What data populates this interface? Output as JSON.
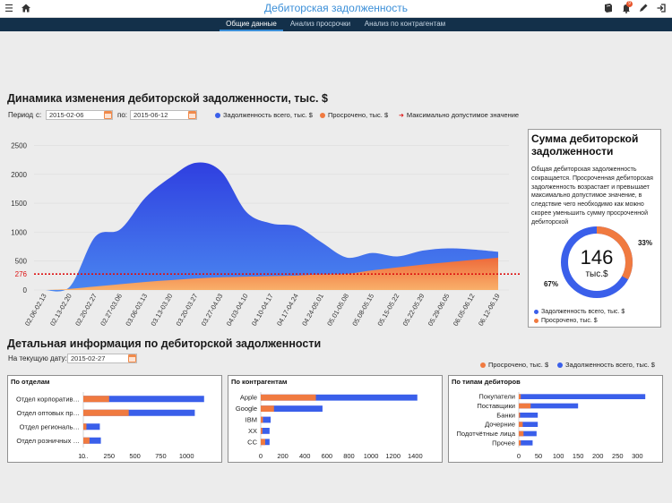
{
  "header": {
    "title": "Дебиторская задолженность",
    "notification_count": "9"
  },
  "tabs": [
    {
      "label": "Общие данные",
      "active": true
    },
    {
      "label": "Анализ просрочки",
      "active": false
    },
    {
      "label": "Анализ по контрагентам",
      "active": false
    }
  ],
  "dynamics": {
    "title": "Динамика изменения дебиторской задолженности, тыс. $",
    "period_label": "Период",
    "from_label": "с:",
    "from_value": "2015-02-06",
    "to_label": "по:",
    "to_value": "2015-06-12",
    "legend": {
      "total": "Задолженность всего, тыс. $",
      "overdue": "Просрочено, тыс. $",
      "max": "Максимально допустимое значение"
    }
  },
  "colors": {
    "total": "#3a5fea",
    "overdue": "#f07a40",
    "max_line": "#dd1111",
    "accent": "#3b8fd8",
    "tabbar": "#13304a"
  },
  "chart_data": [
    {
      "type": "area",
      "x": [
        "02.06-02.13",
        "02.13-02.20",
        "02.20-02.27",
        "02.27-03.06",
        "03.06-03.13",
        "03.13-03.20",
        "03.20-03.27",
        "03.27-04.03",
        "04.03-04.10",
        "04.10-04.17",
        "04.17-04.24",
        "04.24-05.01",
        "05.01-05.08",
        "05.08-05.15",
        "05.15-05.22",
        "05.22-05.29",
        "05.29-06.05",
        "06.05-06.12",
        "06.12-06.19"
      ],
      "series": [
        {
          "name": "Задолженность всего, тыс. $",
          "values": [
            0,
            60,
            920,
            1050,
            1600,
            1950,
            2200,
            2050,
            1350,
            1150,
            1100,
            820,
            560,
            640,
            580,
            680,
            720,
            700,
            660
          ]
        },
        {
          "name": "Просрочено, тыс. $",
          "values": [
            0,
            20,
            60,
            100,
            140,
            170,
            200,
            220,
            230,
            240,
            250,
            270,
            280,
            340,
            390,
            440,
            480,
            520,
            560
          ]
        }
      ],
      "max_value": 276,
      "max_label": "276",
      "yticks": [
        0,
        500,
        1000,
        1500,
        2000,
        2500
      ],
      "ylim": [
        0,
        2600
      ]
    },
    {
      "type": "bar",
      "title": "По отделам",
      "categories": [
        "Отдел корпоратив…",
        "Отдел оптовых пр…",
        "Отдел региональ…",
        "Отдел розничных …"
      ],
      "series": [
        {
          "name": "Просрочено, тыс. $",
          "values": [
            250,
            440,
            30,
            60
          ]
        },
        {
          "name": "Задолженность всего, тыс. $",
          "values": [
            1170,
            1080,
            160,
            170
          ]
        }
      ],
      "xticks": [
        "0",
        "250",
        "500",
        "750",
        "1000",
        "1…"
      ],
      "xlim": [
        0,
        1250
      ]
    },
    {
      "type": "bar",
      "title": "По контрагентам",
      "categories": [
        "Apple",
        "Google",
        "IBM",
        "XX",
        "CC"
      ],
      "series": [
        {
          "name": "Просрочено, тыс. $",
          "values": [
            500,
            120,
            20,
            15,
            40
          ]
        },
        {
          "name": "Задолженность всего, тыс. $",
          "values": [
            1420,
            560,
            90,
            80,
            80
          ]
        }
      ],
      "xticks": [
        "0",
        "200",
        "400",
        "600",
        "800",
        "1000",
        "1200",
        "1400"
      ],
      "xlim": [
        0,
        1560
      ]
    },
    {
      "type": "bar",
      "title": "По типам дебиторов",
      "categories": [
        "Покупатели",
        "Поставщики",
        "Банки",
        "Дочерние",
        "Подотчётные лица",
        "Прочее"
      ],
      "series": [
        {
          "name": "Просрочено, тыс. $",
          "values": [
            5,
            30,
            3,
            10,
            12,
            5
          ]
        },
        {
          "name": "Задолженность всего, тыс. $",
          "values": [
            320,
            150,
            48,
            48,
            45,
            35
          ]
        }
      ],
      "xticks": [
        "0",
        "50",
        "100",
        "150",
        "200",
        "250",
        "300"
      ],
      "xlim": [
        0,
        340
      ]
    }
  ],
  "summary": {
    "title": "Сумма дебиторской задолженности",
    "text": "Общая дебиторская задолженность сокращается. Просроченная дебиторская задолженность возрастает и превышает максимально допустимое значение, в следствие чего необходимо как можно скорее уменьшить сумму просроченной дебиторской",
    "value": "146",
    "unit": "тыс.$",
    "pct_overdue": "33%",
    "pct_total": "67%",
    "donut_fraction_overdue": 0.33,
    "legend_total": "Задолженность всего, тыс. $",
    "legend_overdue": "Просрочено, тыс. $"
  },
  "details": {
    "title": "Детальная информация по дебиторской задолженности",
    "date_label": "На текущую дату:",
    "date_value": "2015-02-27",
    "legend_overdue": "Просрочено, тыс. $",
    "legend_total": "Задолженность всего, тыс. $"
  }
}
